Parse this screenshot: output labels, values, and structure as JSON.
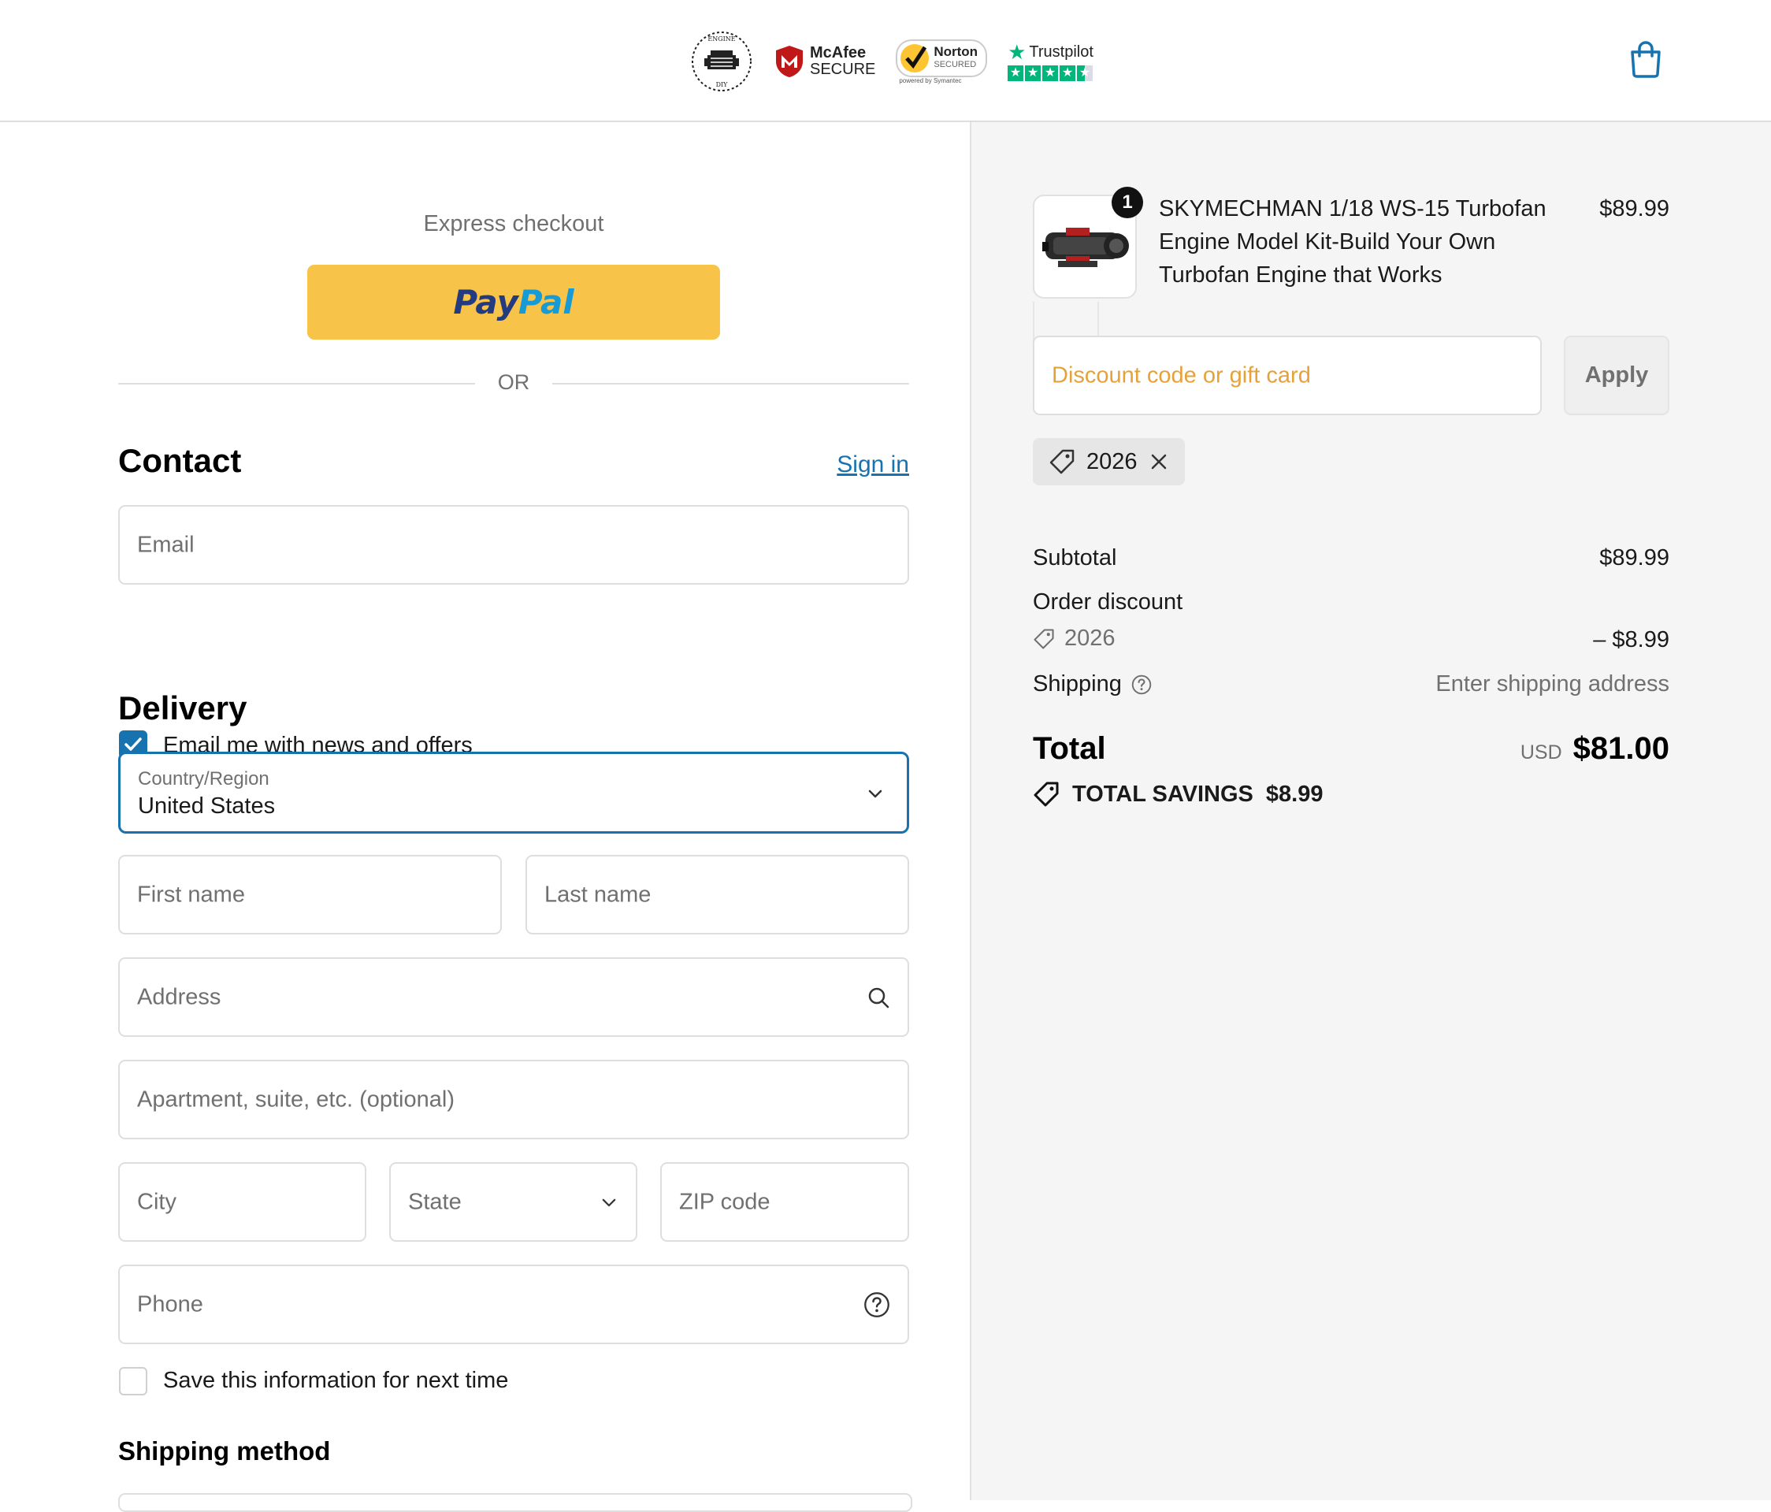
{
  "header": {
    "badges": {
      "engine_logo": {
        "top_text": "ENGINE",
        "bottom_text": "DIY"
      },
      "mcafee": {
        "brand": "McAfee",
        "sub": "SECURE"
      },
      "norton": {
        "brand": "Norton",
        "sub": "SECURED",
        "powered": "powered by Symantec"
      },
      "trustpilot": {
        "brand": "Trustpilot"
      }
    },
    "cart_icon": "shopping-bag-icon"
  },
  "express": {
    "label": "Express checkout",
    "paypal_pay": "Pay",
    "paypal_pal": "Pal",
    "or": "OR"
  },
  "contact": {
    "title": "Contact",
    "sign_in": "Sign in",
    "email_placeholder": "Email",
    "news_checkbox_label": "Email me with news and offers",
    "news_checked": true
  },
  "delivery": {
    "title": "Delivery",
    "country_label": "Country/Region",
    "country_value": "United States",
    "first_name": "First name",
    "last_name": "Last name",
    "address": "Address",
    "apartment": "Apartment, suite, etc. (optional)",
    "city": "City",
    "state": "State",
    "zip": "ZIP code",
    "phone": "Phone",
    "save_info_label": "Save this information for next time",
    "save_checked": false
  },
  "shipping_method": {
    "title": "Shipping method"
  },
  "summary": {
    "product": {
      "quantity": "1",
      "title": "SKYMECHMAN 1/18 WS-15 Turbofan Engine Model Kit-Build Your Own Turbofan Engine that Works",
      "price": "$89.99"
    },
    "discount_placeholder": "Discount code or gift card",
    "apply": "Apply",
    "applied_code": "2026",
    "subtotal_label": "Subtotal",
    "subtotal_value": "$89.99",
    "order_discount_label": "Order discount",
    "discount_code": "2026",
    "discount_value": "– $8.99",
    "shipping_label": "Shipping",
    "shipping_value": "Enter shipping address",
    "total_label": "Total",
    "currency": "USD",
    "total_value": "$81.00",
    "savings_label": "TOTAL SAVINGS",
    "savings_value": "$8.99"
  },
  "colors": {
    "accent": "#1773b0",
    "paypal": "#f7c349",
    "discount_placeholder": "#e6a23a"
  }
}
